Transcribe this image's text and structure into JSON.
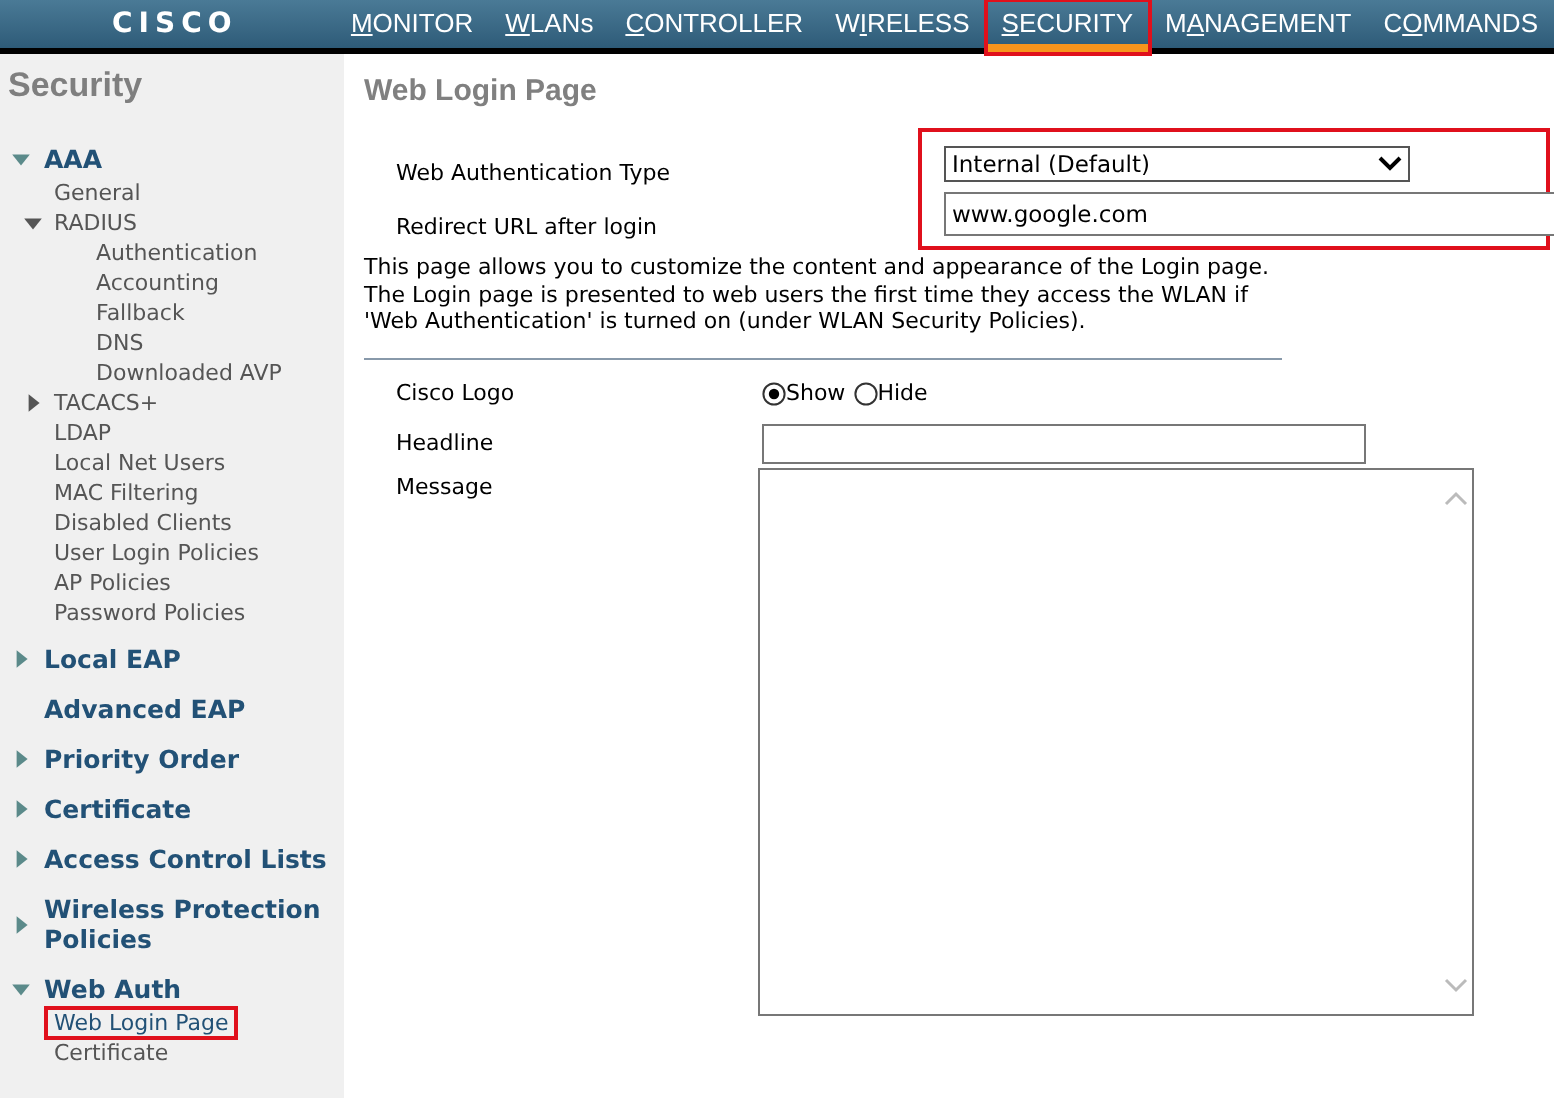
{
  "brand": "CISCO",
  "nav": [
    {
      "key": "M",
      "post": "ONITOR",
      "selected": false,
      "highlighted": false
    },
    {
      "key": "W",
      "post": "LANs",
      "selected": false,
      "highlighted": false
    },
    {
      "key": "C",
      "post": "ONTROLLER",
      "selected": false,
      "highlighted": false
    },
    {
      "pre": "W",
      "key": "I",
      "post": "RELESS",
      "selected": false,
      "highlighted": false
    },
    {
      "key": "S",
      "post": "ECURITY",
      "selected": true,
      "highlighted": true
    },
    {
      "pre": "M",
      "key": "A",
      "post": "NAGEMENT",
      "selected": false,
      "highlighted": false
    },
    {
      "pre": "C",
      "key": "O",
      "post": "MMANDS",
      "selected": false,
      "highlighted": false
    }
  ],
  "sidebar": {
    "title": "Security",
    "sections": [
      {
        "label": "AAA",
        "kind": "folder",
        "expanded": true,
        "children": [
          {
            "label": "General",
            "kind": "leaf",
            "selected": false,
            "highlighted": false
          },
          {
            "label": "RADIUS",
            "kind": "folder",
            "expanded": true,
            "children": [
              {
                "label": "Authentication",
                "kind": "leaf",
                "selected": false,
                "highlighted": false
              },
              {
                "label": "Accounting",
                "kind": "leaf",
                "selected": false,
                "highlighted": false
              },
              {
                "label": "Fallback",
                "kind": "leaf",
                "selected": false,
                "highlighted": false
              },
              {
                "label": "DNS",
                "kind": "leaf",
                "selected": false,
                "highlighted": false
              },
              {
                "label": "Downloaded AVP",
                "kind": "leaf",
                "selected": false,
                "highlighted": false
              }
            ]
          },
          {
            "label": "TACACS+",
            "kind": "folder",
            "expanded": false
          },
          {
            "label": "LDAP",
            "kind": "leaf",
            "selected": false,
            "highlighted": false
          },
          {
            "label": "Local Net Users",
            "kind": "leaf",
            "selected": false,
            "highlighted": false
          },
          {
            "label": "MAC Filtering",
            "kind": "leaf",
            "selected": false,
            "highlighted": false
          },
          {
            "label": "Disabled Clients",
            "kind": "leaf",
            "selected": false,
            "highlighted": false
          },
          {
            "label": "User Login Policies",
            "kind": "leaf",
            "selected": false,
            "highlighted": false
          },
          {
            "label": "AP Policies",
            "kind": "leaf",
            "selected": false,
            "highlighted": false
          },
          {
            "label": "Password Policies",
            "kind": "leaf",
            "selected": false,
            "highlighted": false
          }
        ]
      },
      {
        "label": "Local EAP",
        "kind": "folder",
        "expanded": false
      },
      {
        "label": "Advanced EAP",
        "kind": "leaf"
      },
      {
        "label": "Priority Order",
        "kind": "folder",
        "expanded": false
      },
      {
        "label": "Certificate",
        "kind": "folder",
        "expanded": false
      },
      {
        "label": "Access Control Lists",
        "kind": "folder",
        "expanded": false
      },
      {
        "label": "Wireless Protection Policies",
        "kind": "folder",
        "expanded": false
      },
      {
        "label": "Web Auth",
        "kind": "folder",
        "expanded": true,
        "children": [
          {
            "label": "Web Login Page",
            "kind": "leaf",
            "selected": true,
            "highlighted": true
          },
          {
            "label": "Certificate",
            "kind": "leaf",
            "selected": false,
            "highlighted": false
          }
        ]
      }
    ]
  },
  "page": {
    "title": "Web Login Page",
    "auth_group": {
      "highlighted": true,
      "type_label": "Web Authentication Type",
      "type_value": "Internal (Default)",
      "url_label": "Redirect URL after login",
      "url_value": "www.google.com"
    },
    "description": [
      "This page allows you to customize the content and appearance of the Login page.",
      "The Login page is presented to web users the first time they access the WLAN if",
      "'Web Authentication' is turned on (under WLAN Security Policies)."
    ],
    "logo_label": "Cisco Logo",
    "logo_options": [
      {
        "label": "Show",
        "selected": true
      },
      {
        "label": "Hide",
        "selected": false
      }
    ],
    "headline_label": "Headline",
    "message_label": "Message"
  }
}
